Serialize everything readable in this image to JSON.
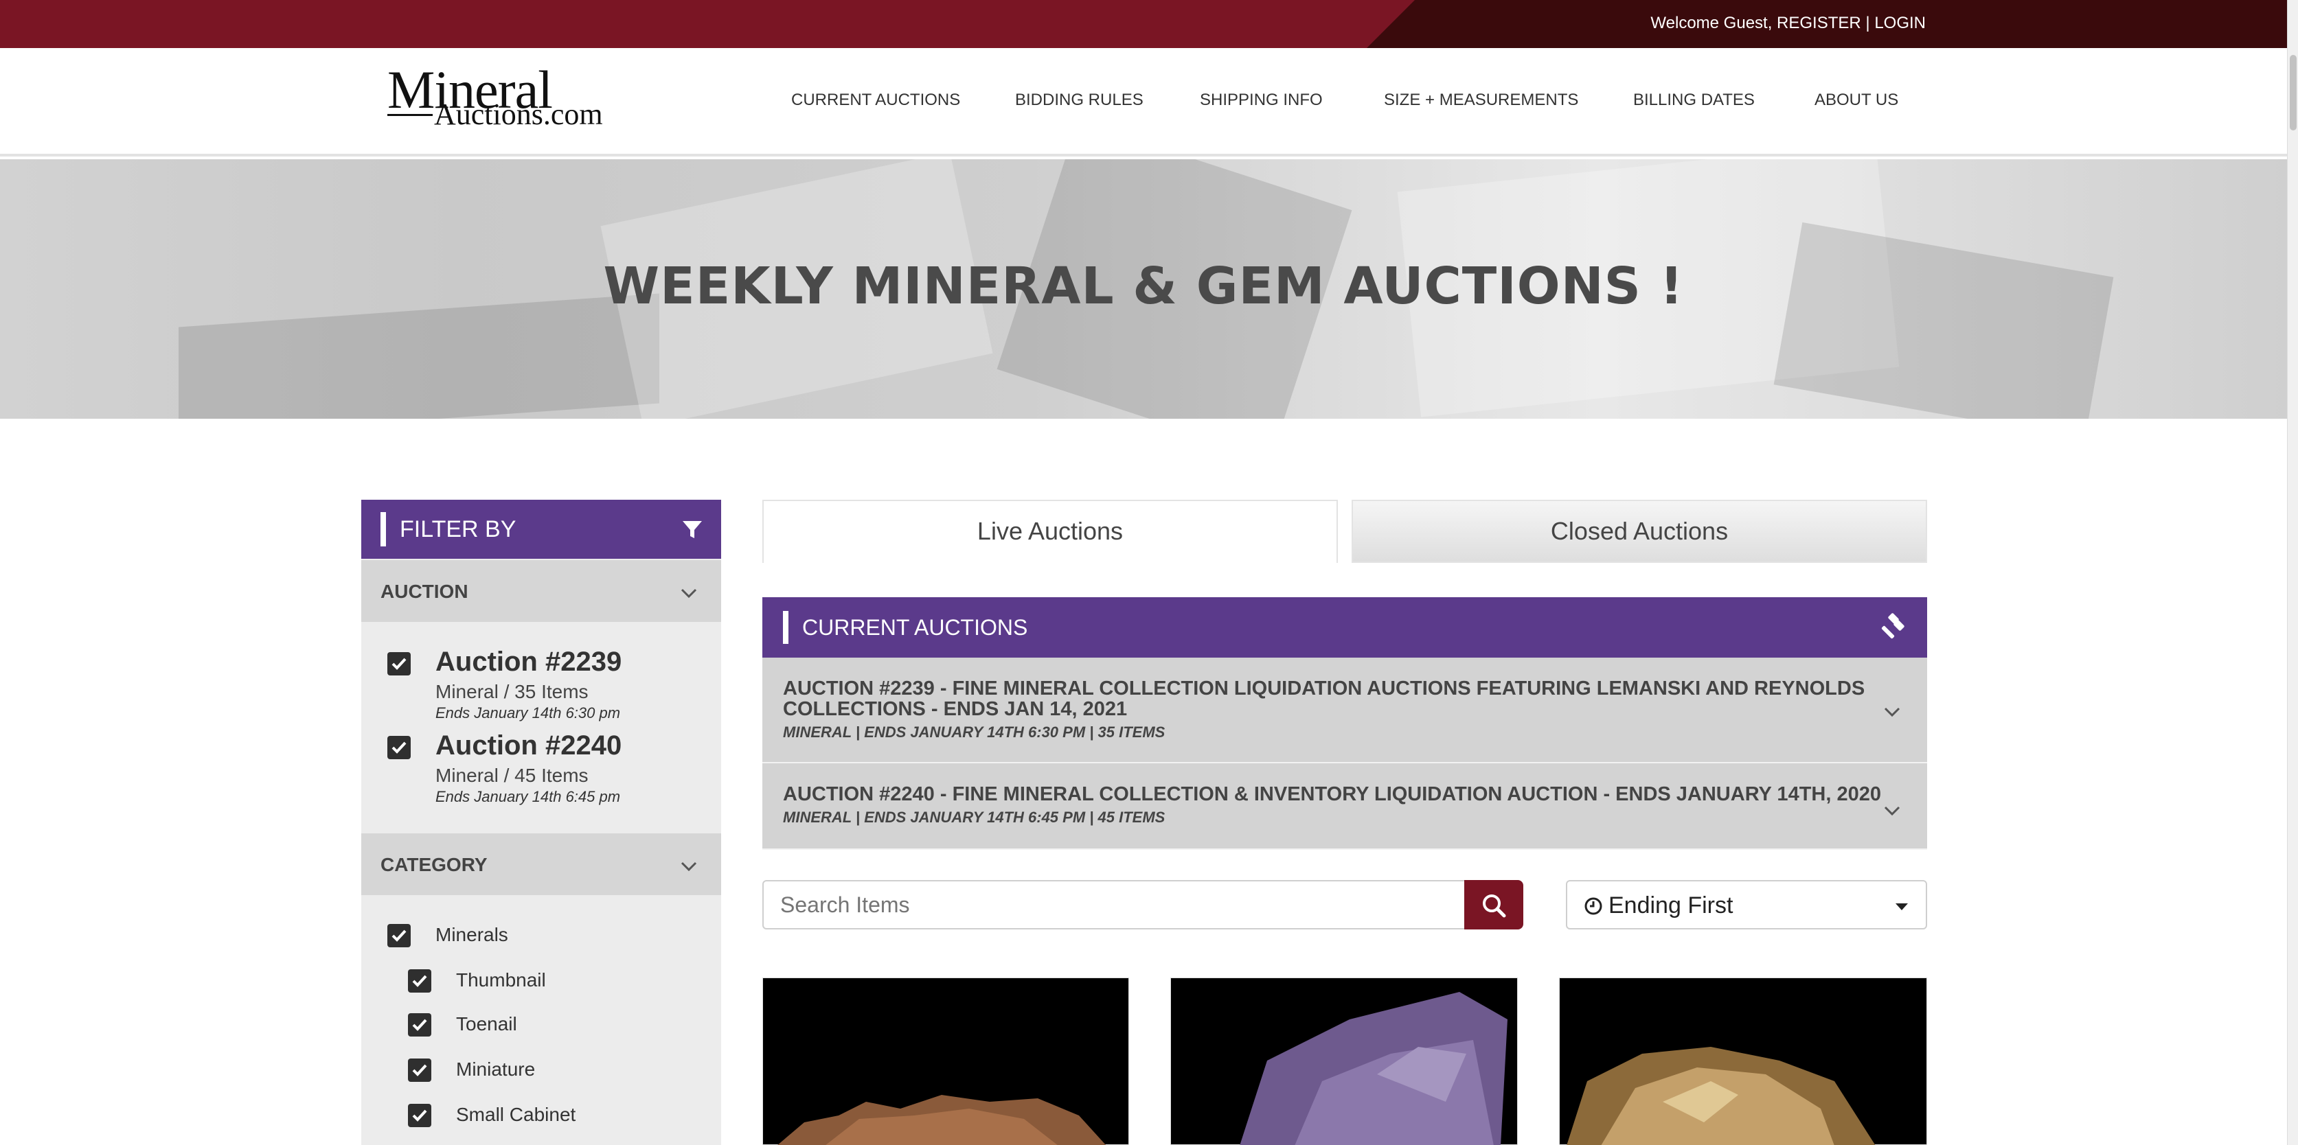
{
  "topbar": {
    "welcome": "Welcome Guest,",
    "register": "REGISTER",
    "separator": "|",
    "login": "LOGIN"
  },
  "logo": {
    "line1": "Mineral",
    "line2": "Auctions.com"
  },
  "nav": {
    "items": [
      {
        "label": "CURRENT AUCTIONS"
      },
      {
        "label": "BIDDING RULES"
      },
      {
        "label": "SHIPPING INFO"
      },
      {
        "label": "SIZE + MEASUREMENTS"
      },
      {
        "label": "BILLING DATES"
      },
      {
        "label": "ABOUT US"
      }
    ]
  },
  "hero": {
    "title": "WEEKLY MINERAL & GEM AUCTIONS !"
  },
  "sidebar": {
    "filter_label": "FILTER BY",
    "auction_section": "AUCTION",
    "auctions": [
      {
        "title": "Auction #2239",
        "sub": "Mineral / 35 Items",
        "ends": "Ends January 14th 6:30 pm",
        "checked": true
      },
      {
        "title": "Auction #2240",
        "sub": "Mineral / 45 Items",
        "ends": "Ends January 14th 6:45 pm",
        "checked": true
      }
    ],
    "category_section": "CATEGORY",
    "categories": [
      {
        "label": "Minerals",
        "checked": true
      },
      {
        "label": "Thumbnail",
        "checked": true
      },
      {
        "label": "Toenail",
        "checked": true
      },
      {
        "label": "Miniature",
        "checked": true
      },
      {
        "label": "Small Cabinet",
        "checked": true
      }
    ]
  },
  "tabs": {
    "live": "Live Auctions",
    "closed": "Closed Auctions"
  },
  "current": {
    "heading": "CURRENT AUCTIONS",
    "rows": [
      {
        "title": "AUCTION #2239 - FINE MINERAL COLLECTION LIQUIDATION AUCTIONS FEATURING LEMANSKI AND REYNOLDS COLLECTIONS - ENDS JAN 14, 2021",
        "meta": "MINERAL | ENDS JANUARY 14TH 6:30 PM | 35 ITEMS"
      },
      {
        "title": "AUCTION #2240 - FINE MINERAL COLLECTION & INVENTORY LIQUIDATION AUCTION - ENDS JANUARY 14TH, 2020",
        "meta": "MINERAL | ENDS JANUARY 14TH 6:45 PM | 45 ITEMS"
      }
    ]
  },
  "search": {
    "placeholder": "Search Items"
  },
  "sort": {
    "value": "Ending First"
  },
  "colors": {
    "brand": "#7a1524",
    "accent": "#5b3a8b"
  }
}
